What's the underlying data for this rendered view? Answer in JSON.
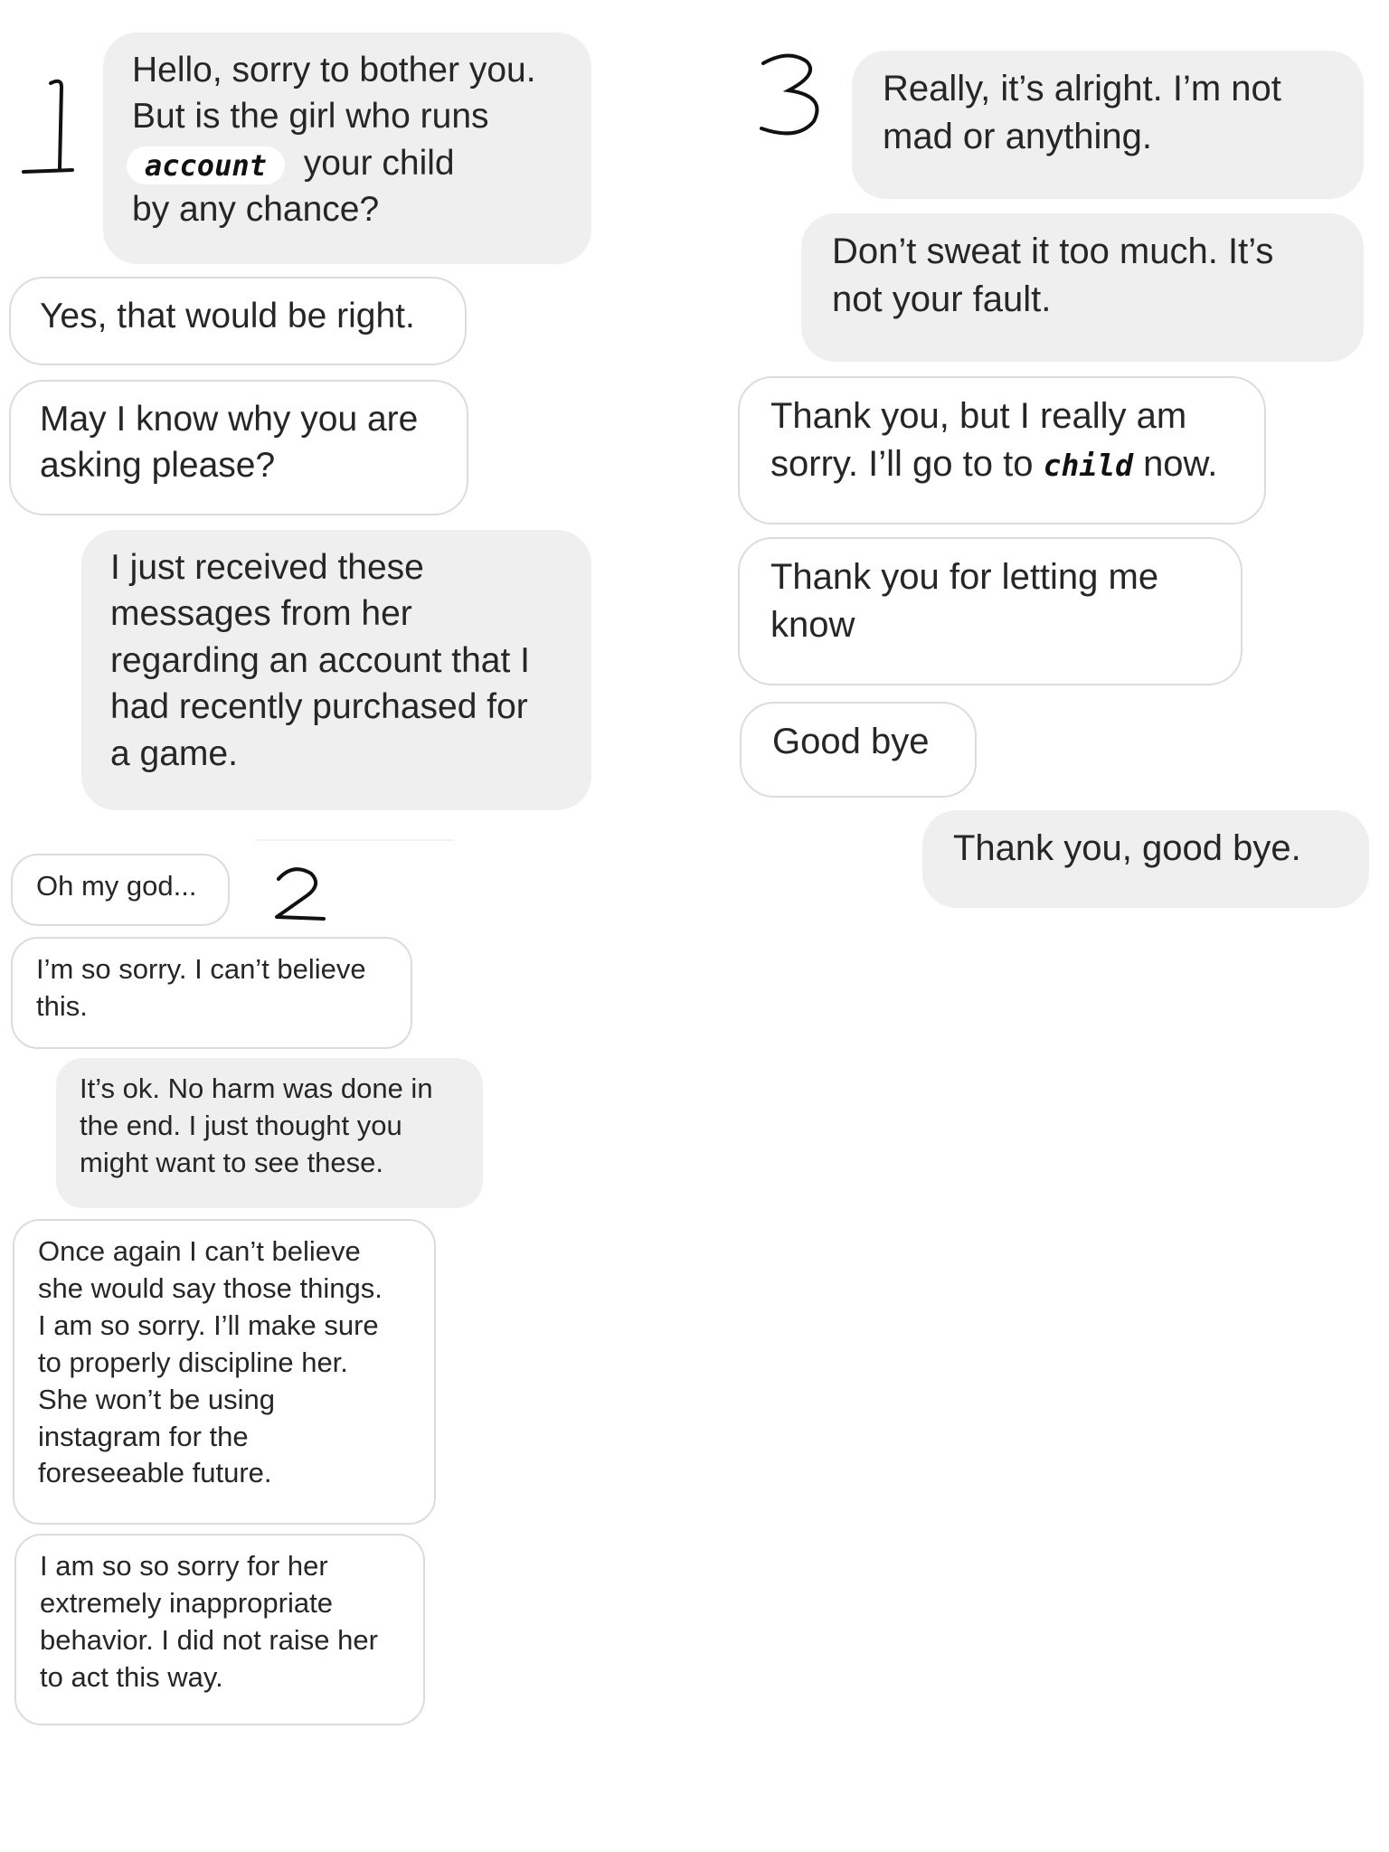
{
  "markers": {
    "one": "1",
    "two": "2",
    "three": "3"
  },
  "column1": {
    "m1": {
      "line1": "Hello, sorry to bother you.",
      "line2": "But is the girl who runs",
      "redacted_word": "account",
      "line3_after": "your child",
      "line4": "by any chance?"
    },
    "m2": {
      "line1": "Yes, that would be right."
    },
    "m3": {
      "line1": "May I know why you are",
      "line2": "asking please?"
    },
    "m4": {
      "line1": "I just received these",
      "line2": "messages from her",
      "line3": "regarding an account that I",
      "line4": "had recently purchased for",
      "line5": "a game."
    }
  },
  "column2": {
    "m1": {
      "line1": "Oh my god..."
    },
    "m2": {
      "line1": "I’m so sorry. I can’t believe",
      "line2": "this."
    },
    "m3": {
      "line1": "It’s ok. No harm was done in",
      "line2": "the end. I just thought you",
      "line3": "might want to see these."
    },
    "m4": {
      "line1": "Once again I can’t believe",
      "line2": "she would say those things.",
      "line3": "I am so sorry. I’ll make sure",
      "line4": "to properly discipline her.",
      "line5": "She won’t be using",
      "line6": "instagram for the",
      "line7": "foreseeable future."
    },
    "m5": {
      "line1": "I am so so sorry for her",
      "line2": "extremely inappropriate",
      "line3": "behavior. I did not raise her",
      "line4": "to act this way."
    }
  },
  "column3": {
    "m1": {
      "line1": "Really, it’s alright. I’m not",
      "line2": "mad or anything."
    },
    "m2": {
      "line1": "Don’t sweat it too much. It’s",
      "line2": "not your fault."
    },
    "m3": {
      "line1": "Thank you, but I really am",
      "line2_before": "sorry. I’ll go to to",
      "handwritten_word": "child",
      "line2_after": "now."
    },
    "m4": {
      "line1": "Thank you for letting me",
      "line2": "know"
    },
    "m5": {
      "line1": "Good bye"
    },
    "m6": {
      "line1": "Thank you, good bye."
    }
  },
  "colors": {
    "incoming_bubble_bg": "#ffffff",
    "incoming_bubble_border": "#dcdcdc",
    "outgoing_bubble_bg": "#efefef",
    "text": "#262626"
  }
}
